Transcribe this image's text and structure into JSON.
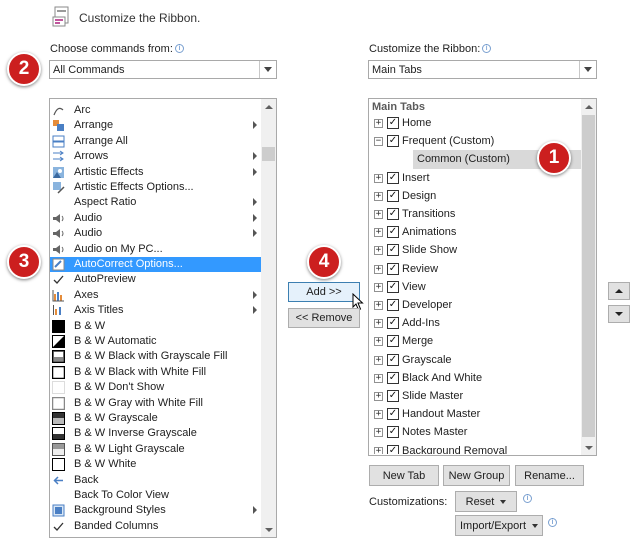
{
  "header": {
    "title": "Customize the Ribbon."
  },
  "left": {
    "label": "Choose commands from:",
    "combo_value": "All Commands",
    "items": [
      {
        "label": "Arc",
        "icon": "arc-icon",
        "sub": false
      },
      {
        "label": "Arrange",
        "icon": "arrange-icon",
        "sub": true
      },
      {
        "label": "Arrange All",
        "icon": "arrange-all-icon",
        "sub": false
      },
      {
        "label": "Arrows",
        "icon": "arrows-icon",
        "sub": true
      },
      {
        "label": "Artistic Effects",
        "icon": "artistic-effects-icon",
        "sub": true
      },
      {
        "label": "Artistic Effects Options...",
        "icon": "artistic-effects-options-icon",
        "sub": false
      },
      {
        "label": "Aspect Ratio",
        "icon": "",
        "sub": true
      },
      {
        "label": "Audio",
        "icon": "speaker-icon",
        "sub": true
      },
      {
        "label": "Audio",
        "icon": "speaker-icon",
        "sub": true
      },
      {
        "label": "Audio on My PC...",
        "icon": "speaker-icon",
        "sub": false
      },
      {
        "label": "AutoCorrect Options...",
        "icon": "autocorrect-icon",
        "sub": false
      },
      {
        "label": "AutoPreview",
        "icon": "check-icon",
        "sub": false
      },
      {
        "label": "Axes",
        "icon": "axes-icon",
        "sub": true
      },
      {
        "label": "Axis Titles",
        "icon": "axis-titles-icon",
        "sub": true
      },
      {
        "label": "B & W",
        "icon": "bw-icon",
        "sub": false
      },
      {
        "label": "B & W Automatic",
        "icon": "bw-automatic-icon",
        "sub": false
      },
      {
        "label": "B & W Black with Grayscale Fill",
        "icon": "bw-grayscale-fill-icon",
        "sub": false
      },
      {
        "label": "B & W Black with White Fill",
        "icon": "bw-white-fill-icon",
        "sub": false
      },
      {
        "label": "B & W Don't Show",
        "icon": "bw-dont-show-icon",
        "sub": false
      },
      {
        "label": "B & W Gray with White Fill",
        "icon": "bw-gray-white-icon",
        "sub": false
      },
      {
        "label": "B & W Grayscale",
        "icon": "bw-grayscale-icon",
        "sub": false
      },
      {
        "label": "B & W Inverse Grayscale",
        "icon": "bw-inverse-icon",
        "sub": false
      },
      {
        "label": "B & W Light Grayscale",
        "icon": "bw-light-icon",
        "sub": false
      },
      {
        "label": "B & W White",
        "icon": "bw-white-icon",
        "sub": false
      },
      {
        "label": "Back",
        "icon": "back-arrow-icon",
        "sub": false
      },
      {
        "label": "Back To Color View",
        "icon": "",
        "sub": false
      },
      {
        "label": "Background Styles",
        "icon": "background-styles-icon",
        "sub": true
      },
      {
        "label": "Banded Columns",
        "icon": "check-icon",
        "sub": false
      }
    ],
    "selected_index": 10
  },
  "middle": {
    "add_label": "Add >>",
    "remove_label": "<< Remove"
  },
  "right": {
    "label": "Customize the Ribbon:",
    "combo_value": "Main Tabs",
    "tree_header": "Main Tabs",
    "tree": [
      {
        "label": "Home",
        "expander": "+",
        "checked": true,
        "indent": 0
      },
      {
        "label": "Frequent (Custom)",
        "expander": "−",
        "checked": true,
        "indent": 0
      },
      {
        "label": "Common (Custom)",
        "expander": "",
        "checked": null,
        "indent": 1
      },
      {
        "label": "Insert",
        "expander": "+",
        "checked": true,
        "indent": 0
      },
      {
        "label": "Design",
        "expander": "+",
        "checked": true,
        "indent": 0
      },
      {
        "label": "Transitions",
        "expander": "+",
        "checked": true,
        "indent": 0
      },
      {
        "label": "Animations",
        "expander": "+",
        "checked": true,
        "indent": 0
      },
      {
        "label": "Slide Show",
        "expander": "+",
        "checked": true,
        "indent": 0
      },
      {
        "label": "Review",
        "expander": "+",
        "checked": true,
        "indent": 0
      },
      {
        "label": "View",
        "expander": "+",
        "checked": true,
        "indent": 0
      },
      {
        "label": "Developer",
        "expander": "+",
        "checked": true,
        "indent": 0
      },
      {
        "label": "Add-Ins",
        "expander": "+",
        "checked": true,
        "indent": 0
      },
      {
        "label": "Merge",
        "expander": "+",
        "checked": true,
        "indent": 0
      },
      {
        "label": "Grayscale",
        "expander": "+",
        "checked": true,
        "indent": 0
      },
      {
        "label": "Black And White",
        "expander": "+",
        "checked": true,
        "indent": 0
      },
      {
        "label": "Slide Master",
        "expander": "+",
        "checked": true,
        "indent": 0
      },
      {
        "label": "Handout Master",
        "expander": "+",
        "checked": true,
        "indent": 0
      },
      {
        "label": "Notes Master",
        "expander": "+",
        "checked": true,
        "indent": 0
      },
      {
        "label": "Background Removal",
        "expander": "+",
        "checked": true,
        "indent": 0
      }
    ],
    "highlight_index": 2,
    "new_tab_label": "New Tab",
    "new_group_label": "New Group",
    "rename_label": "Rename...",
    "customizations_label": "Customizations:",
    "reset_label": "Reset",
    "import_export_label": "Import/Export"
  },
  "badges": [
    "1",
    "2",
    "3",
    "4"
  ],
  "colors": {
    "badge": "#cc1f1f",
    "selection": "#3399ff",
    "highlight": "#d9d9d9"
  }
}
